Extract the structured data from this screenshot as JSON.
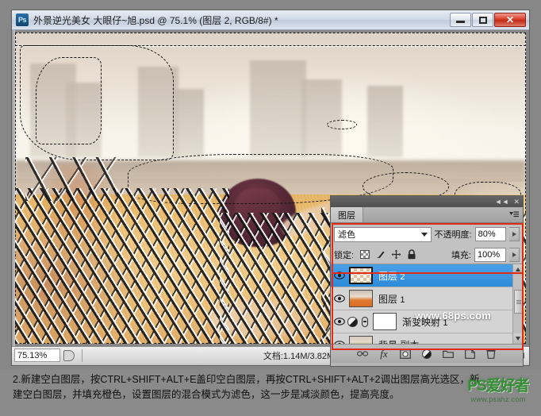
{
  "window": {
    "app_icon": "photoshop-icon",
    "title": "外景逆光美女   大眼仔~旭.psd @ 75.1% (图层 2, RGB/8#) *",
    "minimize_label": "最小化",
    "maximize_label": "最大化",
    "close_label": "✕"
  },
  "statusbar": {
    "zoom": "75.13%",
    "doc_info": "文档:1.14M/3.82M",
    "proxy_icon": "document-proxy-icon",
    "play_arrow": "play-arrow-icon",
    "prev_arrow": "prev-arrow-icon"
  },
  "canvas": {
    "watermark": "www.68ps.com",
    "selection_active": true
  },
  "layers_panel": {
    "tab_label": "图层",
    "collapse_icon": "◄◄",
    "close_icon": "✕",
    "menu_icon": "panel-menu-icon",
    "blend_mode": "滤色",
    "opacity_label": "不透明度:",
    "opacity_value": "80%",
    "lock_label": "锁定:",
    "lock_icons": [
      "lock-transparency-icon",
      "lock-image-icon",
      "lock-position-icon",
      "lock-all-icon"
    ],
    "fill_label": "填充:",
    "fill_value": "100%",
    "accent_highlight": "#e02b18",
    "selected_row_color": "#2f8bd8",
    "layers": [
      {
        "name": "图层",
        "index": "2",
        "selected": true,
        "visible": true,
        "thumb": "checker-transparent",
        "extra_icon": null
      },
      {
        "name": "图层",
        "index": "1",
        "selected": false,
        "visible": true,
        "thumb": "photo-field",
        "extra_icon": null
      },
      {
        "name": "渐变映射",
        "index": "1",
        "selected": false,
        "visible": true,
        "thumb": "white-mask",
        "extra_icon": "adjustment-gradient-map-icon"
      },
      {
        "name": "背景 副本",
        "index": "",
        "selected": false,
        "visible": true,
        "thumb": "photo-background",
        "extra_icon": null
      }
    ],
    "footer_icons": [
      "link-layers-icon",
      "add-fx-icon",
      "add-mask-icon",
      "new-adjustment-layer-icon",
      "new-group-icon",
      "new-layer-icon",
      "delete-layer-icon"
    ]
  },
  "caption": {
    "line1": "2.新建空白图层，按CTRL+SHIFT+ALT+E盖印空白图层，再按CTRL+SHIFT+ALT+2调出图层高光选区，新",
    "line2": "建空白图层，并填充橙色，设置图层的混合模式为滤色，这一步是减淡颜色，提高亮度。"
  },
  "site_watermark": {
    "logo": "PS爱好者",
    "url": "www.psahz.com",
    "color": "#2e8f2e"
  }
}
